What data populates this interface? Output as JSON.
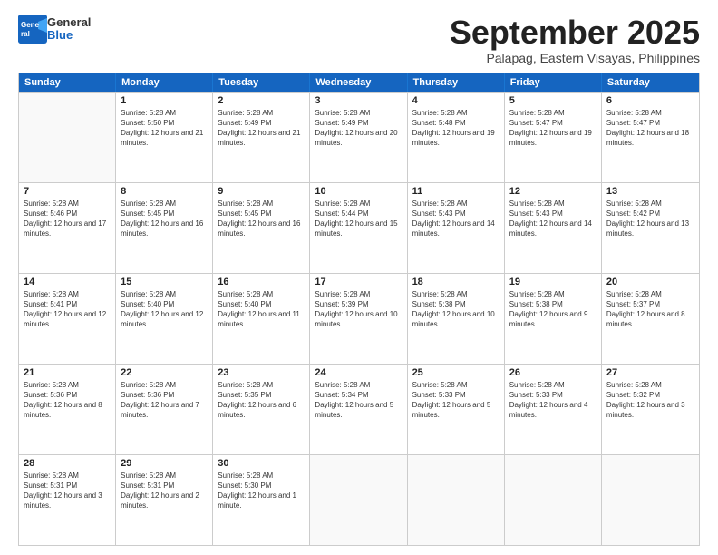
{
  "header": {
    "logo_general": "General",
    "logo_blue": "Blue",
    "month_title": "September 2025",
    "location": "Palapag, Eastern Visayas, Philippines"
  },
  "days_of_week": [
    "Sunday",
    "Monday",
    "Tuesday",
    "Wednesday",
    "Thursday",
    "Friday",
    "Saturday"
  ],
  "weeks": [
    [
      {
        "day": "",
        "sunrise": "",
        "sunset": "",
        "daylight": "",
        "empty": true
      },
      {
        "day": "1",
        "sunrise": "Sunrise: 5:28 AM",
        "sunset": "Sunset: 5:50 PM",
        "daylight": "Daylight: 12 hours and 21 minutes."
      },
      {
        "day": "2",
        "sunrise": "Sunrise: 5:28 AM",
        "sunset": "Sunset: 5:49 PM",
        "daylight": "Daylight: 12 hours and 21 minutes."
      },
      {
        "day": "3",
        "sunrise": "Sunrise: 5:28 AM",
        "sunset": "Sunset: 5:49 PM",
        "daylight": "Daylight: 12 hours and 20 minutes."
      },
      {
        "day": "4",
        "sunrise": "Sunrise: 5:28 AM",
        "sunset": "Sunset: 5:48 PM",
        "daylight": "Daylight: 12 hours and 19 minutes."
      },
      {
        "day": "5",
        "sunrise": "Sunrise: 5:28 AM",
        "sunset": "Sunset: 5:47 PM",
        "daylight": "Daylight: 12 hours and 19 minutes."
      },
      {
        "day": "6",
        "sunrise": "Sunrise: 5:28 AM",
        "sunset": "Sunset: 5:47 PM",
        "daylight": "Daylight: 12 hours and 18 minutes."
      }
    ],
    [
      {
        "day": "7",
        "sunrise": "Sunrise: 5:28 AM",
        "sunset": "Sunset: 5:46 PM",
        "daylight": "Daylight: 12 hours and 17 minutes."
      },
      {
        "day": "8",
        "sunrise": "Sunrise: 5:28 AM",
        "sunset": "Sunset: 5:45 PM",
        "daylight": "Daylight: 12 hours and 16 minutes."
      },
      {
        "day": "9",
        "sunrise": "Sunrise: 5:28 AM",
        "sunset": "Sunset: 5:45 PM",
        "daylight": "Daylight: 12 hours and 16 minutes."
      },
      {
        "day": "10",
        "sunrise": "Sunrise: 5:28 AM",
        "sunset": "Sunset: 5:44 PM",
        "daylight": "Daylight: 12 hours and 15 minutes."
      },
      {
        "day": "11",
        "sunrise": "Sunrise: 5:28 AM",
        "sunset": "Sunset: 5:43 PM",
        "daylight": "Daylight: 12 hours and 14 minutes."
      },
      {
        "day": "12",
        "sunrise": "Sunrise: 5:28 AM",
        "sunset": "Sunset: 5:43 PM",
        "daylight": "Daylight: 12 hours and 14 minutes."
      },
      {
        "day": "13",
        "sunrise": "Sunrise: 5:28 AM",
        "sunset": "Sunset: 5:42 PM",
        "daylight": "Daylight: 12 hours and 13 minutes."
      }
    ],
    [
      {
        "day": "14",
        "sunrise": "Sunrise: 5:28 AM",
        "sunset": "Sunset: 5:41 PM",
        "daylight": "Daylight: 12 hours and 12 minutes."
      },
      {
        "day": "15",
        "sunrise": "Sunrise: 5:28 AM",
        "sunset": "Sunset: 5:40 PM",
        "daylight": "Daylight: 12 hours and 12 minutes."
      },
      {
        "day": "16",
        "sunrise": "Sunrise: 5:28 AM",
        "sunset": "Sunset: 5:40 PM",
        "daylight": "Daylight: 12 hours and 11 minutes."
      },
      {
        "day": "17",
        "sunrise": "Sunrise: 5:28 AM",
        "sunset": "Sunset: 5:39 PM",
        "daylight": "Daylight: 12 hours and 10 minutes."
      },
      {
        "day": "18",
        "sunrise": "Sunrise: 5:28 AM",
        "sunset": "Sunset: 5:38 PM",
        "daylight": "Daylight: 12 hours and 10 minutes."
      },
      {
        "day": "19",
        "sunrise": "Sunrise: 5:28 AM",
        "sunset": "Sunset: 5:38 PM",
        "daylight": "Daylight: 12 hours and 9 minutes."
      },
      {
        "day": "20",
        "sunrise": "Sunrise: 5:28 AM",
        "sunset": "Sunset: 5:37 PM",
        "daylight": "Daylight: 12 hours and 8 minutes."
      }
    ],
    [
      {
        "day": "21",
        "sunrise": "Sunrise: 5:28 AM",
        "sunset": "Sunset: 5:36 PM",
        "daylight": "Daylight: 12 hours and 8 minutes."
      },
      {
        "day": "22",
        "sunrise": "Sunrise: 5:28 AM",
        "sunset": "Sunset: 5:36 PM",
        "daylight": "Daylight: 12 hours and 7 minutes."
      },
      {
        "day": "23",
        "sunrise": "Sunrise: 5:28 AM",
        "sunset": "Sunset: 5:35 PM",
        "daylight": "Daylight: 12 hours and 6 minutes."
      },
      {
        "day": "24",
        "sunrise": "Sunrise: 5:28 AM",
        "sunset": "Sunset: 5:34 PM",
        "daylight": "Daylight: 12 hours and 5 minutes."
      },
      {
        "day": "25",
        "sunrise": "Sunrise: 5:28 AM",
        "sunset": "Sunset: 5:33 PM",
        "daylight": "Daylight: 12 hours and 5 minutes."
      },
      {
        "day": "26",
        "sunrise": "Sunrise: 5:28 AM",
        "sunset": "Sunset: 5:33 PM",
        "daylight": "Daylight: 12 hours and 4 minutes."
      },
      {
        "day": "27",
        "sunrise": "Sunrise: 5:28 AM",
        "sunset": "Sunset: 5:32 PM",
        "daylight": "Daylight: 12 hours and 3 minutes."
      }
    ],
    [
      {
        "day": "28",
        "sunrise": "Sunrise: 5:28 AM",
        "sunset": "Sunset: 5:31 PM",
        "daylight": "Daylight: 12 hours and 3 minutes."
      },
      {
        "day": "29",
        "sunrise": "Sunrise: 5:28 AM",
        "sunset": "Sunset: 5:31 PM",
        "daylight": "Daylight: 12 hours and 2 minutes."
      },
      {
        "day": "30",
        "sunrise": "Sunrise: 5:28 AM",
        "sunset": "Sunset: 5:30 PM",
        "daylight": "Daylight: 12 hours and 1 minute."
      },
      {
        "day": "",
        "sunrise": "",
        "sunset": "",
        "daylight": "",
        "empty": true
      },
      {
        "day": "",
        "sunrise": "",
        "sunset": "",
        "daylight": "",
        "empty": true
      },
      {
        "day": "",
        "sunrise": "",
        "sunset": "",
        "daylight": "",
        "empty": true
      },
      {
        "day": "",
        "sunrise": "",
        "sunset": "",
        "daylight": "",
        "empty": true
      }
    ]
  ]
}
